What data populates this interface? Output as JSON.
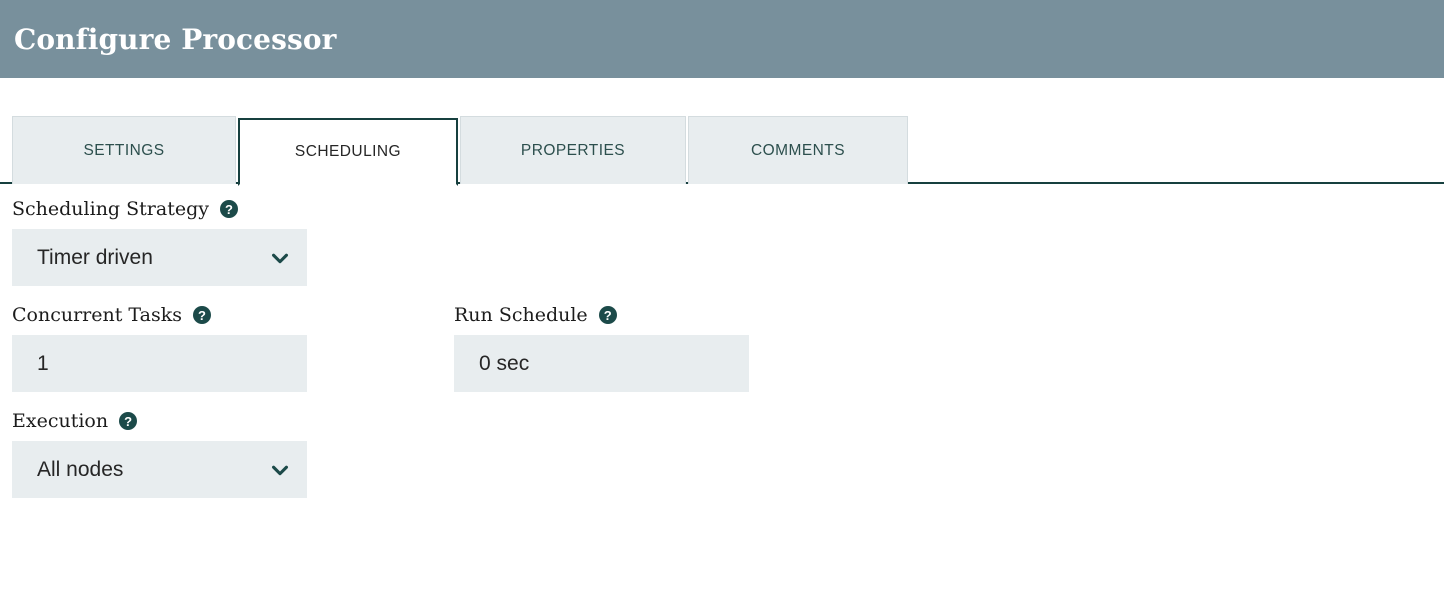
{
  "header": {
    "title": "Configure Processor"
  },
  "tabs": [
    {
      "label": "SETTINGS",
      "active": false,
      "name": "tab-settings"
    },
    {
      "label": "SCHEDULING",
      "active": true,
      "name": "tab-scheduling"
    },
    {
      "label": "PROPERTIES",
      "active": false,
      "name": "tab-properties"
    },
    {
      "label": "COMMENTS",
      "active": false,
      "name": "tab-comments"
    }
  ],
  "fields": {
    "scheduling_strategy": {
      "label": "Scheduling Strategy",
      "value": "Timer driven",
      "help_glyph": "?",
      "control": "select",
      "chevron_icon": "chevron-down-icon"
    },
    "concurrent_tasks": {
      "label": "Concurrent Tasks",
      "value": "1",
      "help_glyph": "?",
      "control": "text"
    },
    "run_schedule": {
      "label": "Run Schedule",
      "value": "0 sec",
      "help_glyph": "?",
      "control": "text"
    },
    "execution": {
      "label": "Execution",
      "value": "All nodes",
      "help_glyph": "?",
      "control": "select",
      "chevron_icon": "chevron-down-icon"
    }
  },
  "colors": {
    "header_bg": "#78909c",
    "accent_teal": "#17403f",
    "help_icon_bg": "#1c4a49",
    "field_bg": "#e8edef",
    "tab_inactive_bg": "#e8edef",
    "tab_inactive_text": "#2c4f4d",
    "tab_active_text": "#262626"
  }
}
